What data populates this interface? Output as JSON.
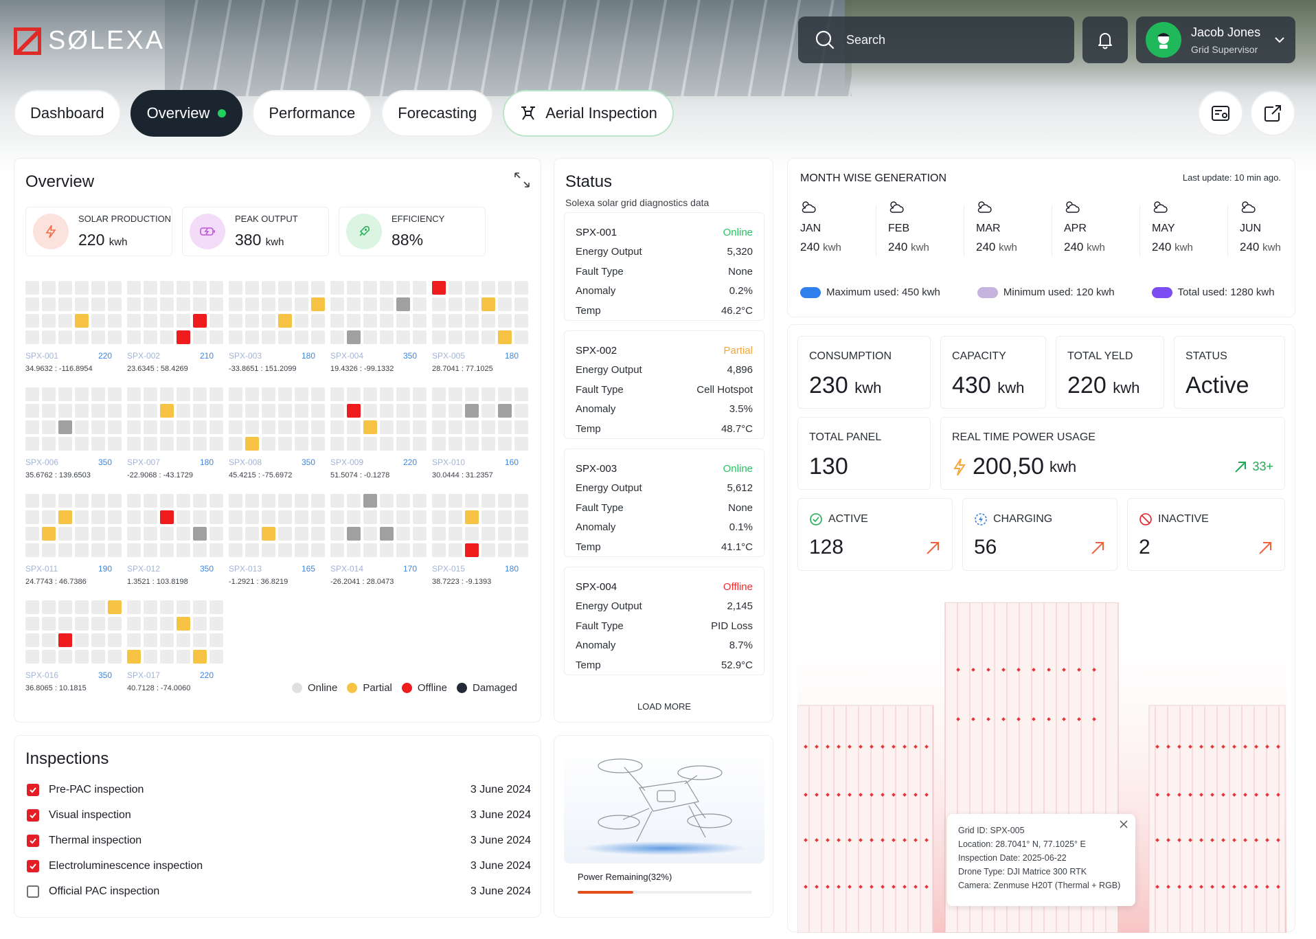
{
  "brand": {
    "name": "SØLEXA"
  },
  "header": {
    "search_placeholder": "Search",
    "user": {
      "name": "Jacob Jones",
      "role": "Grid Supervisor"
    }
  },
  "tabs": [
    {
      "label": "Dashboard"
    },
    {
      "label": "Overview",
      "active": true
    },
    {
      "label": "Performance"
    },
    {
      "label": "Forecasting"
    },
    {
      "label": "Aerial Inspection"
    }
  ],
  "overview": {
    "title": "Overview",
    "kpis": [
      {
        "label": "SOLAR PRODUCTION",
        "value": "220",
        "unit": "kwh",
        "icon": "bolt-icon",
        "color": "#fce2dc"
      },
      {
        "label": "PEAK OUTPUT",
        "value": "380",
        "unit": "kwh",
        "icon": "battery-charging-icon",
        "color": "#f2dcf7"
      },
      {
        "label": "EFFICIENCY",
        "value": "88%",
        "unit": "",
        "icon": "rocket-icon",
        "color": "#dcf5e2"
      }
    ],
    "grids": [
      {
        "id": "SPX-001",
        "value": "220",
        "coord": "34.9632 : -116.8954",
        "cells": {
          "15": "p"
        }
      },
      {
        "id": "SPX-002",
        "value": "210",
        "coord": "23.6345 : 58.4269",
        "cells": {
          "16": "o",
          "21": "o"
        }
      },
      {
        "id": "SPX-003",
        "value": "180",
        "coord": "-33.8651 : 151.2099",
        "cells": {
          "11": "p",
          "15": "p"
        }
      },
      {
        "id": "SPX-004",
        "value": "350",
        "coord": "19.4326 : -99.1332",
        "cells": {
          "10": "d",
          "19": "d"
        }
      },
      {
        "id": "SPX-005",
        "value": "180",
        "coord": "28.7041 : 77.1025",
        "cells": {
          "0": "o",
          "9": "p",
          "22": "p"
        }
      },
      {
        "id": "SPX-006",
        "value": "350",
        "coord": "35.6762 : 139.6503",
        "cells": {
          "14": "d"
        }
      },
      {
        "id": "SPX-007",
        "value": "180",
        "coord": "-22.9068 : -43.1729",
        "cells": {
          "8": "p"
        }
      },
      {
        "id": "SPX-008",
        "value": "350",
        "coord": "45.4215 : -75.6972",
        "cells": {
          "19": "p"
        }
      },
      {
        "id": "SPX-009",
        "value": "220",
        "coord": "51.5074 : -0.1278",
        "cells": {
          "7": "o",
          "14": "p"
        }
      },
      {
        "id": "SPX-010",
        "value": "160",
        "coord": "30.0444 : 31.2357",
        "cells": {
          "8": "d",
          "10": "d"
        }
      },
      {
        "id": "SPX-011",
        "value": "190",
        "coord": "24.7743 : 46.7386",
        "cells": {
          "8": "p",
          "13": "p"
        }
      },
      {
        "id": "SPX-012",
        "value": "350",
        "coord": "1.3521 : 103.8198",
        "cells": {
          "8": "o",
          "16": "d"
        }
      },
      {
        "id": "SPX-013",
        "value": "165",
        "coord": "-1.2921 : 36.8219",
        "cells": {
          "14": "p"
        }
      },
      {
        "id": "SPX-014",
        "value": "170",
        "coord": "-26.2041 : 28.0473",
        "cells": {
          "2": "d",
          "13": "d",
          "15": "d"
        }
      },
      {
        "id": "SPX-015",
        "value": "180",
        "coord": "38.7223 : -9.1393",
        "cells": {
          "8": "p",
          "20": "o"
        }
      },
      {
        "id": "SPX-016",
        "value": "350",
        "coord": "36.8065 : 10.1815",
        "cells": {
          "5": "p",
          "14": "o"
        }
      },
      {
        "id": "SPX-017",
        "value": "220",
        "coord": "40.7128 : -74.0060",
        "cells": {
          "9": "p",
          "18": "p",
          "22": "p"
        }
      }
    ],
    "legend": [
      {
        "label": "Online",
        "color": "#e0e0e0"
      },
      {
        "label": "Partial",
        "color": "#f6c344"
      },
      {
        "label": "Offline",
        "color": "#ee1c1c"
      },
      {
        "label": "Damaged",
        "color": "#232a36"
      }
    ]
  },
  "status": {
    "title": "Status",
    "subtitle": "Solexa solar grid diagnostics data",
    "labels": {
      "energy": "Energy Output",
      "fault": "Fault Type",
      "anomaly": "Anomaly",
      "temp": "Temp"
    },
    "items": [
      {
        "id": "SPX-001",
        "state": "Online",
        "state_color": "#22c55e",
        "energy": "5,320",
        "fault": "None",
        "anomaly": "0.2%",
        "temp": "46.2°C"
      },
      {
        "id": "SPX-002",
        "state": "Partial",
        "state_color": "#f4a63a",
        "energy": "4,896",
        "fault": "Cell Hotspot",
        "anomaly": "3.5%",
        "temp": "48.7°C"
      },
      {
        "id": "SPX-003",
        "state": "Online",
        "state_color": "#22c55e",
        "energy": "5,612",
        "fault": "None",
        "anomaly": "0.1%",
        "temp": "41.1°C"
      },
      {
        "id": "SPX-004",
        "state": "Offline",
        "state_color": "#ef2d2d",
        "energy": "2,145",
        "fault": "PID Loss",
        "anomaly": "8.7%",
        "temp": "52.9°C"
      }
    ],
    "load_more": "LOAD MORE"
  },
  "month_wise": {
    "title": "MONTH WISE GENERATION",
    "last_update": "Last update: 10 min ago.",
    "months": [
      {
        "month": "JAN",
        "value": "240",
        "unit": "kwh"
      },
      {
        "month": "FEB",
        "value": "240",
        "unit": "kwh"
      },
      {
        "month": "MAR",
        "value": "240",
        "unit": "kwh"
      },
      {
        "month": "APR",
        "value": "240",
        "unit": "kwh"
      },
      {
        "month": "MAY",
        "value": "240",
        "unit": "kwh"
      },
      {
        "month": "JUN",
        "value": "240",
        "unit": "kwh"
      }
    ],
    "legend": [
      {
        "label": "Maximum used: 450 kwh",
        "color": "#2f80ed"
      },
      {
        "label": "Minimum used: 120 kwh",
        "color": "#c6b3de"
      },
      {
        "label": "Total used: 1280 kwh",
        "color": "#7b4df2"
      }
    ]
  },
  "stats": {
    "consumption": {
      "label": "CONSUMPTION",
      "value": "230",
      "unit": "kwh"
    },
    "capacity": {
      "label": "CAPACITY",
      "value": "430",
      "unit": "kwh"
    },
    "total_yield": {
      "label": "TOTAL YELD",
      "value": "220",
      "unit": "kwh"
    },
    "status": {
      "label": "STATUS",
      "value": "Active"
    },
    "total_panel": {
      "label": "TOTAL PANEL",
      "value": "130"
    },
    "realtime": {
      "label": "REAL TIME POWER USAGE",
      "value": "200,50",
      "unit": "kwh",
      "delta": "33+"
    },
    "active": {
      "label": "ACTIVE",
      "value": "128"
    },
    "charging": {
      "label": "CHARGING",
      "value": "56"
    },
    "inactive": {
      "label": "INACTIVE",
      "value": "2"
    }
  },
  "inspections": {
    "title": "Inspections",
    "items": [
      {
        "label": "Pre-PAC inspection",
        "date": "3 June 2024",
        "checked": true
      },
      {
        "label": "Visual inspection",
        "date": "3 June 2024",
        "checked": true
      },
      {
        "label": "Thermal inspection",
        "date": "3 June 2024",
        "checked": true
      },
      {
        "label": "Electroluminescence inspection",
        "date": "3 June 2024",
        "checked": true
      },
      {
        "label": "Official PAC inspection",
        "date": "3 June 2024",
        "checked": false
      }
    ]
  },
  "drone": {
    "power_label": "Power Remaining(32%)",
    "power_fraction": 0.32
  },
  "tooltip": {
    "lines": [
      "Grid ID: SPX-005",
      "Location: 28.7041° N, 77.1025° E",
      "Inspection Date: 2025-06-22",
      "Drone Type: DJI Matrice 300 RTK",
      "Camera: Zenmuse H20T (Thermal + RGB)"
    ]
  }
}
